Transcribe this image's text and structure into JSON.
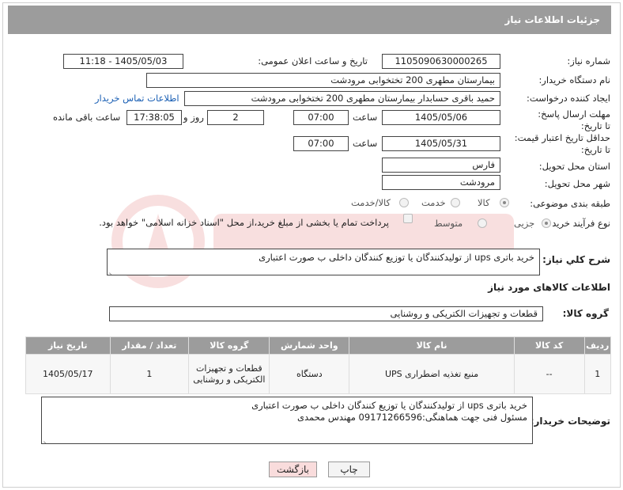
{
  "header": {
    "title": "جزئیات اطلاعات نیاز"
  },
  "form": {
    "need_number_label": "شماره نیاز:",
    "need_number": "1105090630000265",
    "announce_label": "تاریخ و ساعت اعلان عمومی:",
    "announce_value": "1405/05/03 - 11:18",
    "buyer_org_label": "نام دستگاه خریدار:",
    "buyer_org": "بیمارستان مطهری  200 تختخوابی مرودشت",
    "creator_label": "ایجاد کننده درخواست:",
    "creator": "حمید باقری حسابدار بیمارستان مطهری  200 تختخوابی مرودشت",
    "contact_link": "اطلاعات تماس خریدار",
    "reply_deadline_label": "مهلت ارسال پاسخ: تا تاریخ:",
    "reply_date": "1405/05/06",
    "time_label": "ساعت",
    "reply_time": "07:00",
    "days_value": "2",
    "days_label": "روز و",
    "remaining_time": "17:38:05",
    "remaining_label": "ساعت باقی مانده",
    "price_validity_label": "حداقل تاریخ اعتبار قیمت: تا تاریخ:",
    "price_date": "1405/05/31",
    "price_time": "07:00",
    "province_label": "استان محل تحویل:",
    "province": "فارس",
    "city_label": "شهر محل تحویل:",
    "city": "مرودشت",
    "category_label": "طبقه بندی موضوعی:",
    "category_options": [
      "کالا",
      "خدمت",
      "کالا/خدمت"
    ],
    "process_label": "نوع فرآیند خرید :",
    "process_options": [
      "جزیی",
      "متوسط"
    ],
    "payment_note": "پرداخت تمام یا بخشی از مبلغ خرید،از محل \"اسناد خزانه اسلامی\" خواهد بود."
  },
  "summary": {
    "label": "شرح کلي نياز:",
    "text": "خرید باتری ups از تولیدکنندگان یا توزیع کنندگان داخلی ب صورت اعتباری"
  },
  "goods": {
    "section_title": "اطلاعات کالاهای مورد نیاز",
    "group_label": "گروه کالا:",
    "group_value": "قطعات و تجهیزات الکتریکی و روشنایی",
    "columns": [
      "ردیف",
      "کد کالا",
      "نام کالا",
      "واحد شمارش",
      "گروه کالا",
      "تعداد / مقدار",
      "تاریخ نیاز"
    ],
    "rows": [
      {
        "row": "1",
        "code": "--",
        "name": "منبع تغذیه اضطراری UPS",
        "unit": "دستگاه",
        "group": "قطعات و تجهیزات الکتریکی و روشنایی",
        "qty": "1",
        "date": "1405/05/17"
      }
    ]
  },
  "buyer_notes": {
    "label": "توضیحات خریدار:",
    "line1": "خرید باتری ups از تولیدکنندگان یا توزیع کنندگان داخلی ب صورت اعتباری",
    "line2": "مسئول فنی جهت هماهنگی:09171266596 مهندس محمدی"
  },
  "buttons": {
    "print": "چاپ",
    "back": "بازگشت"
  },
  "colors": {
    "header_bg": "#9c9c9c",
    "link": "#1a5fb4",
    "back_bg": "#f9dcdc"
  }
}
